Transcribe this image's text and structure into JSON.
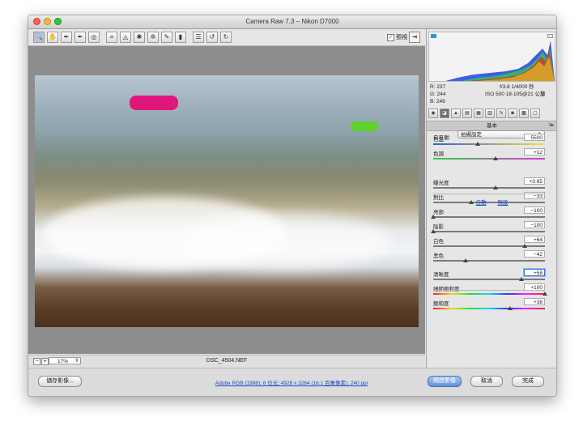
{
  "window": {
    "title": "Camera Raw 7.3  –  Nikon D7000"
  },
  "toolbar": {
    "tools": [
      {
        "name": "zoom-tool",
        "glyph": "🔍"
      },
      {
        "name": "hand-tool",
        "glyph": "✋"
      },
      {
        "name": "white-balance-tool",
        "glyph": "✒"
      },
      {
        "name": "color-sampler-tool",
        "glyph": "✒"
      },
      {
        "name": "targeted-adjustment-tool",
        "glyph": "◎"
      },
      {
        "name": "crop-tool",
        "glyph": "⌗"
      },
      {
        "name": "straighten-tool",
        "glyph": "◬"
      },
      {
        "name": "spot-removal-tool",
        "glyph": "✱"
      },
      {
        "name": "red-eye-tool",
        "glyph": "✲"
      },
      {
        "name": "adjustment-brush-tool",
        "glyph": "✎"
      },
      {
        "name": "graduated-filter-tool",
        "glyph": "▮"
      },
      {
        "name": "preferences-tool",
        "glyph": "☰"
      },
      {
        "name": "rotate-left-tool",
        "glyph": "↺"
      },
      {
        "name": "rotate-right-tool",
        "glyph": "↻"
      }
    ],
    "preview_label": "預視",
    "fullscreen_glyph": "⇥"
  },
  "status": {
    "zoom": "17%",
    "filename": "DSC_4504.NEF",
    "zoom_minus": "−",
    "zoom_plus": "+"
  },
  "readout": {
    "r": "R:  237",
    "g": "G:  244",
    "b": "B:  249"
  },
  "exif": {
    "aperture_shutter": "f/3.8    1/4000 秒",
    "iso_lens": "ISO 500    18-105@21 公釐"
  },
  "panel_tabs": [
    "◉",
    "◪",
    "▲",
    "▤",
    "▦",
    "▥",
    "fx",
    "◙",
    "▩",
    "▢"
  ],
  "panel": {
    "section_title": "基本",
    "white_balance_label": "白平衡:",
    "white_balance_value": "拍攝設定",
    "auto_label": "自動",
    "default_label": "預設"
  },
  "sliders": [
    {
      "label": "色溫",
      "value": "5500",
      "pos": 0.4,
      "track": "temp"
    },
    {
      "label": "色調",
      "value": "+12",
      "pos": 0.56,
      "track": "tint"
    },
    {
      "label": "曝光度",
      "value": "+0.65",
      "pos": 0.56,
      "track": "gray"
    },
    {
      "label": "對比",
      "value": "−33",
      "pos": 0.34,
      "track": "gray"
    },
    {
      "label": "亮部",
      "value": "−100",
      "pos": 0.0,
      "track": "gray"
    },
    {
      "label": "陰影",
      "value": "−100",
      "pos": 0.0,
      "track": "gray"
    },
    {
      "label": "白色",
      "value": "+64",
      "pos": 0.82,
      "track": "gray"
    },
    {
      "label": "黑色",
      "value": "−42",
      "pos": 0.29,
      "track": "gray"
    },
    {
      "label": "清晰度",
      "value": "+58",
      "pos": 0.79,
      "track": "gray",
      "focus": true
    },
    {
      "label": "細節飽和度",
      "value": "+100",
      "pos": 1.0,
      "track": "sat"
    },
    {
      "label": "飽和度",
      "value": "+38",
      "pos": 0.69,
      "track": "sat"
    }
  ],
  "bottom": {
    "save_label": "儲存影像...",
    "info_link": "Adobe RGB (1998); 8 位元; 4928 x 3264 (16.1 百萬像素); 240 ppi",
    "open_label": "開啟影像",
    "cancel_label": "取消",
    "done_label": "完成"
  },
  "colors": {
    "accent": "#5f93d8",
    "link": "#1a48c7",
    "clip_shadow": "#2f96d8"
  }
}
